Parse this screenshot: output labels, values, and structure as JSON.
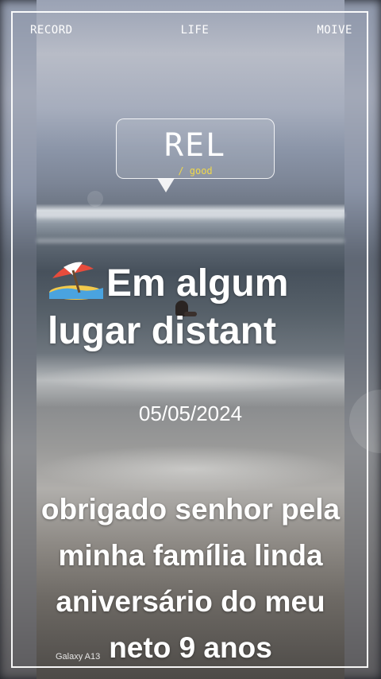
{
  "nav": {
    "left": "RECORD",
    "center": "LIFE",
    "right": "MOIVE"
  },
  "bubble": {
    "title": "REL",
    "subtitle": "/ good"
  },
  "headline": {
    "icon": "beach-umbrella-icon",
    "line1": "Em algum",
    "line2": "lugar distant"
  },
  "date": "05/05/2024",
  "caption": {
    "line1": "obrigado senhor pela",
    "line2": "minha família linda",
    "line3": "aniversário do meu",
    "line4": "neto 9 anos"
  },
  "watermark": "Galaxy A13",
  "colors": {
    "frame": "#ffffff",
    "subtitle_accent": "#f0d84a",
    "text": "#ffffff"
  }
}
